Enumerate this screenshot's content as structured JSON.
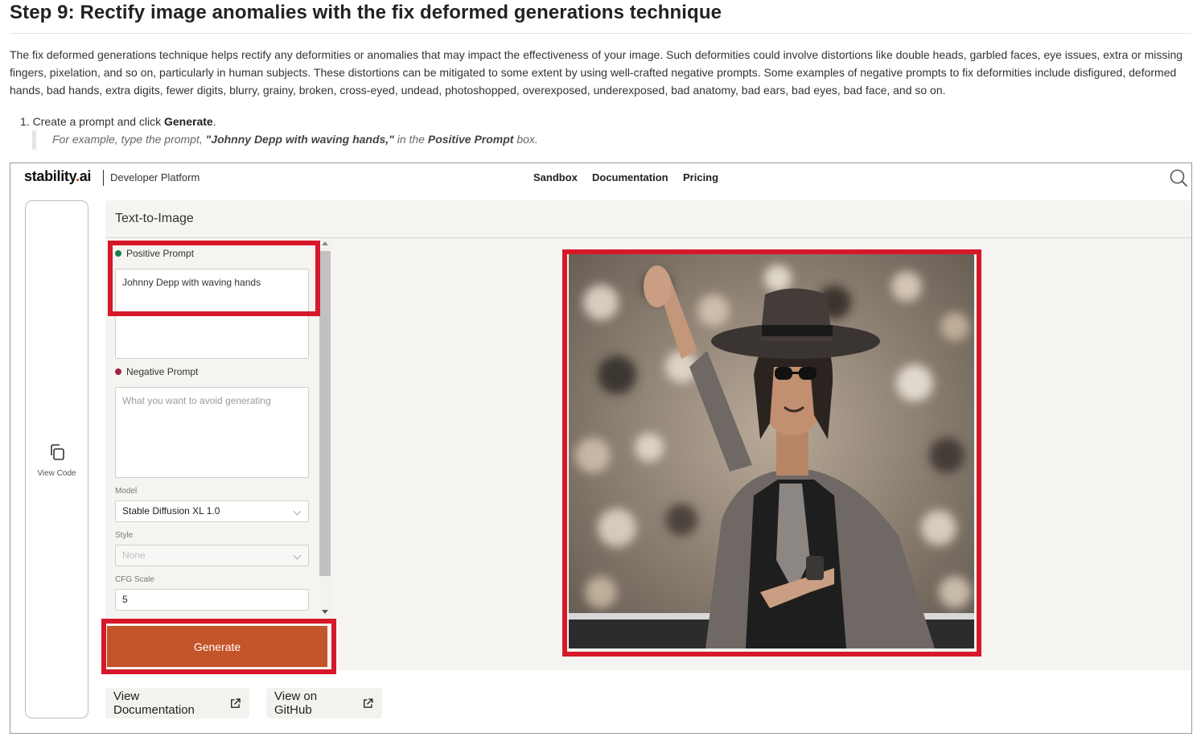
{
  "article": {
    "title": "Step 9: Rectify image anomalies with the fix deformed generations technique",
    "intro": "The fix deformed generations technique helps rectify any deformities or anomalies that may impact the effectiveness of your image. Such deformities could involve distortions like double heads, garbled faces, eye issues, extra or missing fingers, pixelation, and so on, particularly in human subjects. These distortions can be mitigated to some extent by using well-crafted negative prompts. Some examples of negative prompts to fix deformities include disfigured, deformed hands, bad hands, extra digits, fewer digits, blurry, grainy, broken, cross-eyed, undead, photoshopped, overexposed, underexposed, bad anatomy, bad ears, bad eyes, bad face, and so on.",
    "step_number": "1.",
    "step_text": "Create a prompt and click ",
    "step_bold": "Generate",
    "step_end": ".",
    "note_pre": "For example, type the prompt, ",
    "note_prompt": "\"Johnny Depp with waving hands,\"",
    "note_mid": " in the ",
    "note_box": "Positive Prompt",
    "note_end": " box."
  },
  "app": {
    "logo_main": "stability",
    "logo_dot": ".",
    "logo_ai": "ai",
    "platform": "Developer Platform",
    "nav": [
      "Sandbox",
      "Documentation",
      "Pricing"
    ],
    "sidebar_view_code": "View Code",
    "panel_title": "Text-to-Image",
    "positive_label": "Positive Prompt",
    "positive_value": "Johnny Depp with waving hands",
    "negative_label": "Negative Prompt",
    "negative_placeholder": "What you want to avoid generating",
    "model_label": "Model",
    "model_value": "Stable Diffusion XL 1.0",
    "style_label": "Style",
    "style_value": "None",
    "cfg_label": "CFG Scale",
    "cfg_value": "5",
    "generate_label": "Generate",
    "view_docs": "View Documentation",
    "view_github": "View on GitHub"
  },
  "colors": {
    "highlight": "#d6182a",
    "generate": "#c4542a",
    "positive_dot": "#1a7f4b",
    "negative_dot": "#9c2347",
    "brand_dot": "#c8372b"
  }
}
